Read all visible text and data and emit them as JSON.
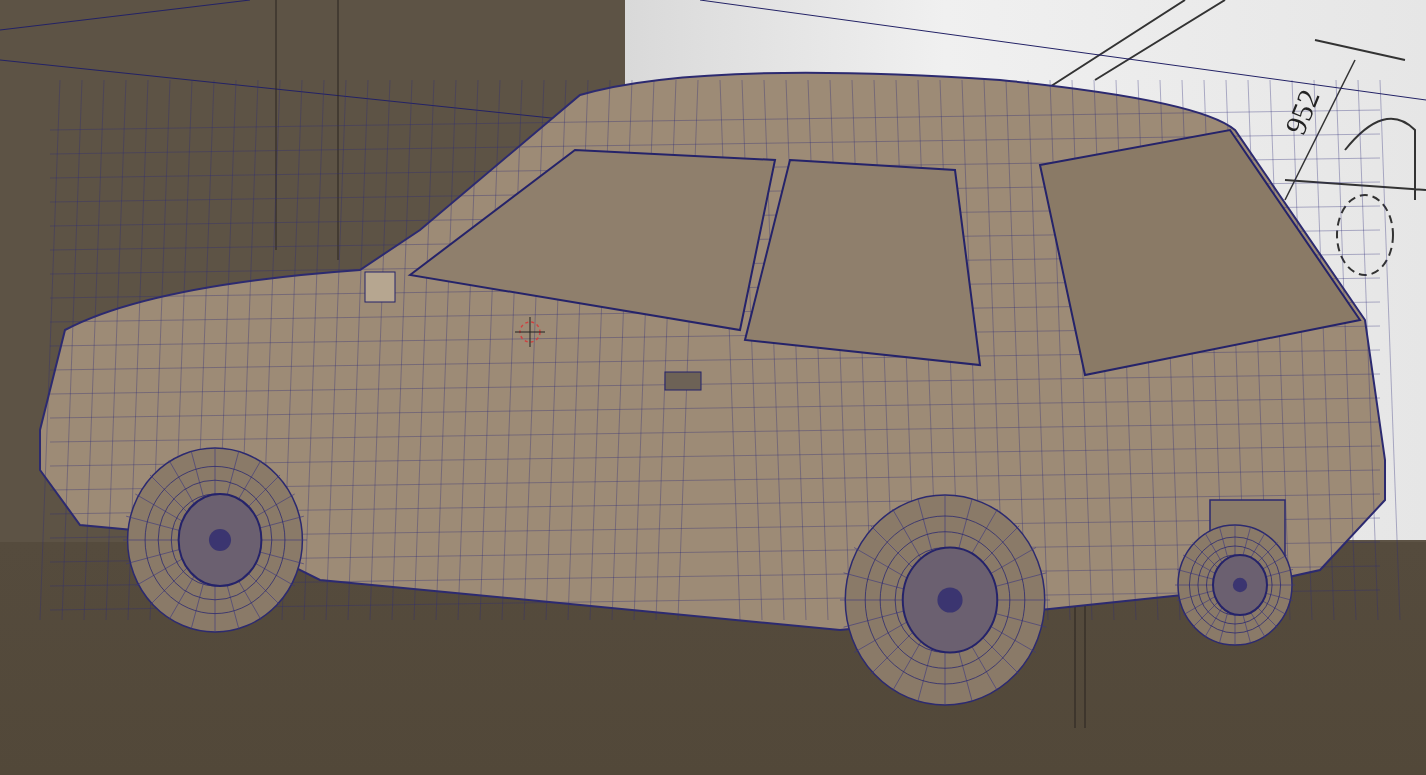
{
  "viewport": {
    "reference_image": {
      "dimension_label": "952"
    }
  }
}
